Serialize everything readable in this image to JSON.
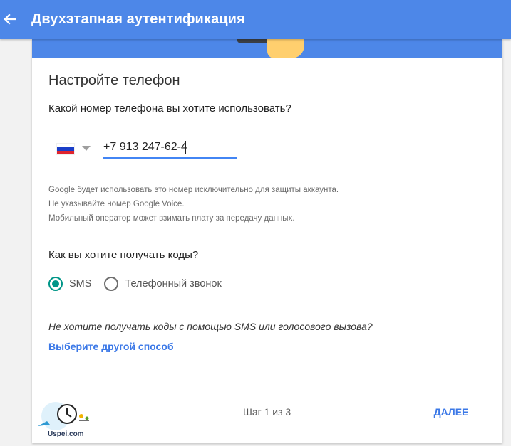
{
  "appbar": {
    "title": "Двухэтапная аутентификация",
    "back_icon": "arrow-back-icon",
    "color": "#4d87e8"
  },
  "form": {
    "heading": "Настройте телефон",
    "phone_question": "Какой номер телефона вы хотите использовать?",
    "country_flag": "russia-flag-icon",
    "phone_value": "+7 913 247-62-4",
    "notes": [
      "Google будет использовать это номер исключительно для защиты аккаунта.",
      "Не указывайте номер Google Voice.",
      "Мобильный оператор может взимать плату за передачу данных."
    ],
    "codes_question": "Как вы хотите получать коды?",
    "options": [
      {
        "label": "SMS",
        "selected": true
      },
      {
        "label": "Телефонный звонок",
        "selected": false
      }
    ],
    "alt_question": "Не хотите получать коды с помощью SMS или голосового вызова?",
    "alt_link": "Выберите другой способ"
  },
  "footer": {
    "step": "Шаг 1 из 3",
    "next": "ДАЛЕЕ"
  },
  "watermark": {
    "text": "Uspei.com"
  },
  "colors": {
    "accent": "#3b78e7",
    "radio": "#009688",
    "input_underline": "#4285f4"
  }
}
